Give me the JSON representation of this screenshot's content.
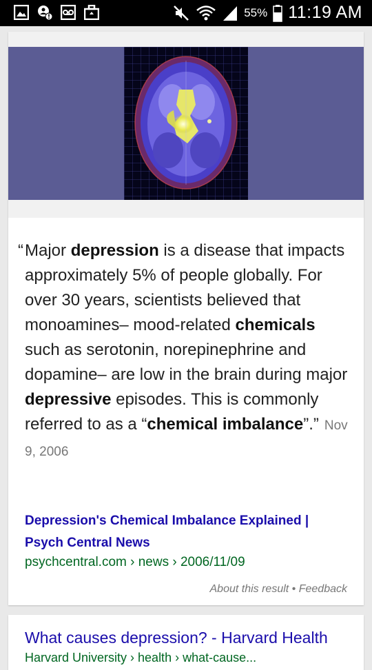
{
  "status_bar": {
    "icons": [
      "gallery-icon",
      "account-alert-icon",
      "voicemail-icon",
      "briefcase-icon",
      "mute-icon",
      "wifi-icon",
      "signal-icon",
      "battery-icon"
    ],
    "battery_text": "55%",
    "time": "11:19 AM"
  },
  "card1": {
    "image_icon": "brain-scan-image",
    "band_color": "#5b5c94",
    "quote": {
      "open_mark": "“",
      "p1": "Major ",
      "b1": "depression",
      "p2": " is a disease that impacts approximately 5% of people globally. For over 30 years, scientists believed that monoamines– mood-related ",
      "b2": "chemicals",
      "p3": " such as serotonin, norepinephrine and dopamine– are low in the brain during major ",
      "b3": "depressive",
      "p4": " episodes. This is commonly referred to as a “",
      "b4": "chemical imbalance",
      "p5": "”.”",
      "date": "Nov 9, 2006"
    },
    "result": {
      "title": "Depression's Chemical Imbalance Explained | Psych Central News",
      "url": "psychcentral.com › news › 2006/11/09"
    },
    "footer": {
      "about": "About this result",
      "separator": " • ",
      "feedback": "Feedback"
    }
  },
  "card2": {
    "title": "What causes depression? - Harvard Health",
    "url": "Harvard University › health › what-cause..."
  },
  "colors": {
    "link": "#1a0dab",
    "url": "#006621",
    "meta": "#777777"
  }
}
